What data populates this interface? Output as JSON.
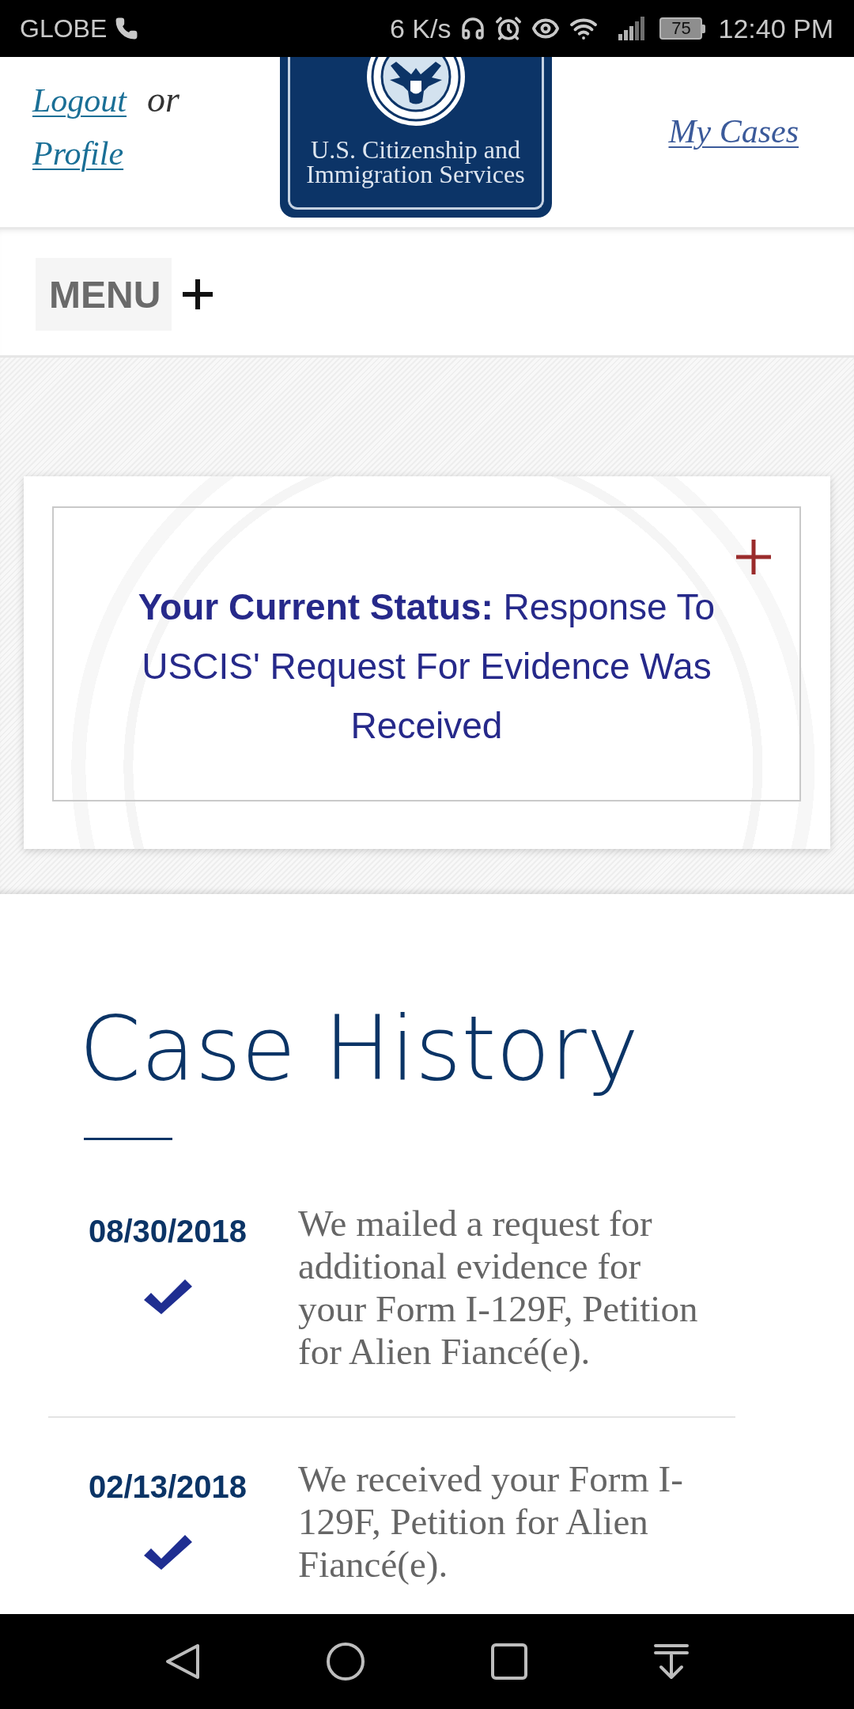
{
  "status_bar": {
    "carrier": "GLOBE",
    "network_speed": "6 K/s",
    "battery": "75",
    "time": "12:40 PM"
  },
  "header": {
    "logout_link": "Logout",
    "separator": "or",
    "profile_link": "Profile",
    "logo_text": "U.S. Citizenship and Immigration Services",
    "my_cases_link": "My Cases"
  },
  "menu": {
    "label": "MENU",
    "expanded": false
  },
  "status_card": {
    "text": "**Your Current Status:** Response To USCIS' Request For Evidence Was Received",
    "expanded": false
  },
  "case_history": {
    "title": "Case History",
    "entries": [
      {
        "date": "08/30/2018",
        "description": "We mailed a request for additional evidence for your Form I-129F, Petition for Alien Fiancé(e).",
        "completed": true
      },
      {
        "date": "02/13/2018",
        "description": "We received your Form I-​129F, Petition for Alien Fiancé(e).",
        "completed": true
      }
    ]
  }
}
